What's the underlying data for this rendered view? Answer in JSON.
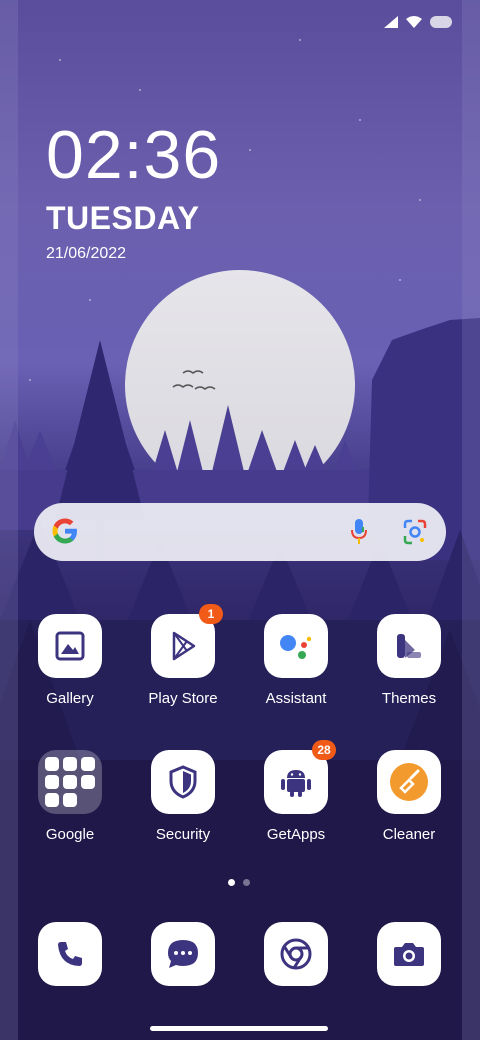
{
  "status_bar": {
    "icons": [
      "signal-icon",
      "wifi-icon",
      "battery-icon"
    ]
  },
  "clock": {
    "time": "02:36",
    "day": "TUESDAY",
    "date": "21/06/2022"
  },
  "search_bar": {
    "icons": [
      "google-logo-icon",
      "microphone-icon",
      "lens-icon"
    ]
  },
  "apps": [
    {
      "label": "Gallery",
      "icon": "gallery-icon"
    },
    {
      "label": "Play Store",
      "icon": "play-store-icon",
      "badge": "1"
    },
    {
      "label": "Assistant",
      "icon": "assistant-icon"
    },
    {
      "label": "Themes",
      "icon": "themes-icon"
    },
    {
      "label": "Google",
      "icon": "folder-icon"
    },
    {
      "label": "Security",
      "icon": "shield-icon"
    },
    {
      "label": "GetApps",
      "icon": "android-icon",
      "badge": "28"
    },
    {
      "label": "Cleaner",
      "icon": "broom-icon"
    }
  ],
  "page_indicator": {
    "total": 2,
    "active": 1
  },
  "dock": [
    {
      "icon": "phone-icon"
    },
    {
      "icon": "messages-icon"
    },
    {
      "icon": "chrome-icon"
    },
    {
      "icon": "camera-icon"
    }
  ],
  "colors": {
    "accent": "#3d3480",
    "badge": "#f25a17",
    "google_blue": "#4285F4",
    "google_red": "#EA4335",
    "google_yellow": "#FBBC05",
    "google_green": "#34A853",
    "cleaner_orange": "#f29a2e"
  }
}
